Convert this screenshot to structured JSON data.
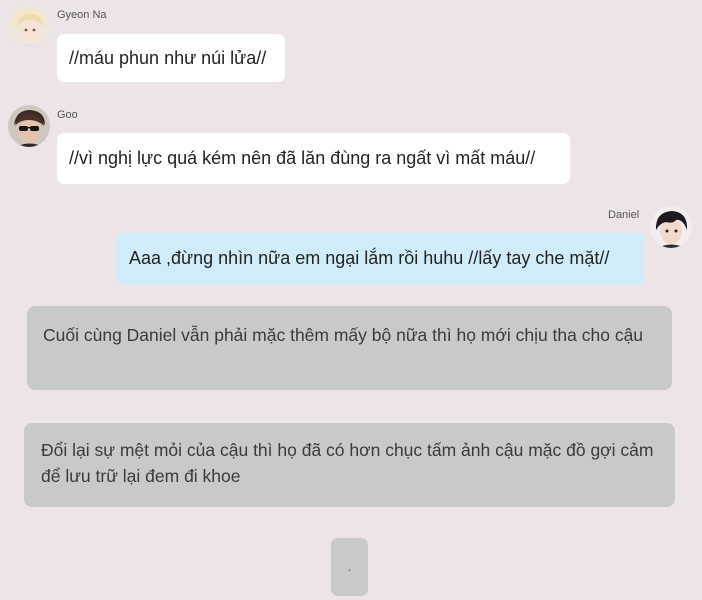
{
  "messages": [
    {
      "sender": "Gyeon Na",
      "text": "//máu phun như núi lửa//",
      "side": "left",
      "avatar": "blonde-character-avatar-icon"
    },
    {
      "sender": "Goo",
      "text": "//vì nghị lực quá kém nên đã lăn đùng ra ngất vì mất máu//",
      "side": "left",
      "avatar": "sunglasses-character-avatar-icon"
    },
    {
      "sender": "Daniel",
      "text": "Aaa ,đừng nhìn nữa em ngại lắm rồi huhu //lấy tay che mặt//",
      "side": "right",
      "avatar": "dark-hair-character-avatar-icon"
    }
  ],
  "narrations": [
    "Cuối cùng Daniel vẫn phải mặc thêm mấy bộ nữa thì họ mới chịu tha cho cậu",
    "Đổi lại sự mệt mỏi của cậu thì họ đã có hơn chục tấm ảnh cậu mặc đồ gợi cảm để lưu trữ lại đem đi khoe"
  ],
  "end_card": ".",
  "colors": {
    "background": "#ece4e7",
    "incoming_bubble": "#ffffff",
    "outgoing_bubble": "#d0ecf8",
    "narration_box": "#c9c9c9"
  }
}
